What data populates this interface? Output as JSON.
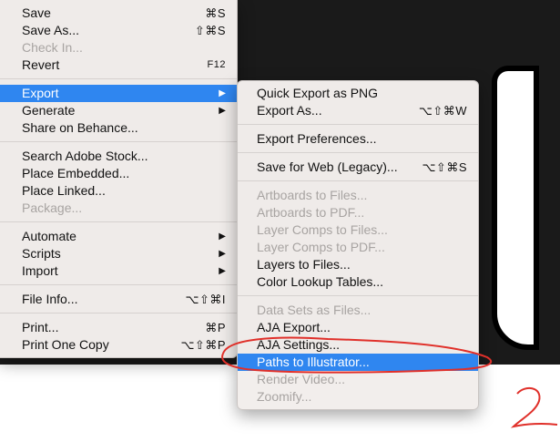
{
  "main_menu": [
    {
      "label": "Save",
      "shortcut": "⌘S",
      "type": "item"
    },
    {
      "label": "Save As...",
      "shortcut": "⇧⌘S",
      "type": "item"
    },
    {
      "label": "Check In...",
      "shortcut": "",
      "type": "disabled"
    },
    {
      "label": "Revert",
      "shortcut": "F12",
      "type": "item"
    },
    {
      "label": "Export",
      "shortcut": "",
      "type": "submenu-hl"
    },
    {
      "label": "Generate",
      "shortcut": "",
      "type": "submenu"
    },
    {
      "label": "Share on Behance...",
      "shortcut": "",
      "type": "item"
    },
    {
      "label": "Search Adobe Stock...",
      "shortcut": "",
      "type": "item"
    },
    {
      "label": "Place Embedded...",
      "shortcut": "",
      "type": "item"
    },
    {
      "label": "Place Linked...",
      "shortcut": "",
      "type": "item"
    },
    {
      "label": "Package...",
      "shortcut": "",
      "type": "disabled"
    },
    {
      "label": "Automate",
      "shortcut": "",
      "type": "submenu"
    },
    {
      "label": "Scripts",
      "shortcut": "",
      "type": "submenu"
    },
    {
      "label": "Import",
      "shortcut": "",
      "type": "submenu"
    },
    {
      "label": "File Info...",
      "shortcut": "⌥⇧⌘I",
      "type": "item"
    },
    {
      "label": "Print...",
      "shortcut": "⌘P",
      "type": "item"
    },
    {
      "label": "Print One Copy",
      "shortcut": "⌥⇧⌘P",
      "type": "item"
    }
  ],
  "export_submenu": [
    {
      "label": "Quick Export as PNG",
      "shortcut": "",
      "type": "item"
    },
    {
      "label": "Export As...",
      "shortcut": "⌥⇧⌘W",
      "type": "item"
    },
    {
      "label": "Export Preferences...",
      "shortcut": "",
      "type": "item"
    },
    {
      "label": "Save for Web (Legacy)...",
      "shortcut": "⌥⇧⌘S",
      "type": "item"
    },
    {
      "label": "Artboards to Files...",
      "shortcut": "",
      "type": "disabled"
    },
    {
      "label": "Artboards to PDF...",
      "shortcut": "",
      "type": "disabled"
    },
    {
      "label": "Layer Comps to Files...",
      "shortcut": "",
      "type": "disabled"
    },
    {
      "label": "Layer Comps to PDF...",
      "shortcut": "",
      "type": "disabled"
    },
    {
      "label": "Layers to Files...",
      "shortcut": "",
      "type": "item"
    },
    {
      "label": "Color Lookup Tables...",
      "shortcut": "",
      "type": "item"
    },
    {
      "label": "Data Sets as Files...",
      "shortcut": "",
      "type": "disabled"
    },
    {
      "label": "AJA Export...",
      "shortcut": "",
      "type": "item"
    },
    {
      "label": "AJA Settings...",
      "shortcut": "",
      "type": "item"
    },
    {
      "label": "Paths to Illustrator...",
      "shortcut": "",
      "type": "hl"
    },
    {
      "label": "Render Video...",
      "shortcut": "",
      "type": "disabled"
    },
    {
      "label": "Zoomify...",
      "shortcut": "",
      "type": "disabled"
    }
  ],
  "arrow_glyph": "▶",
  "annotation_text": "2",
  "colors": {
    "highlight": "#2f86f0",
    "annotation": "#e0302a"
  }
}
